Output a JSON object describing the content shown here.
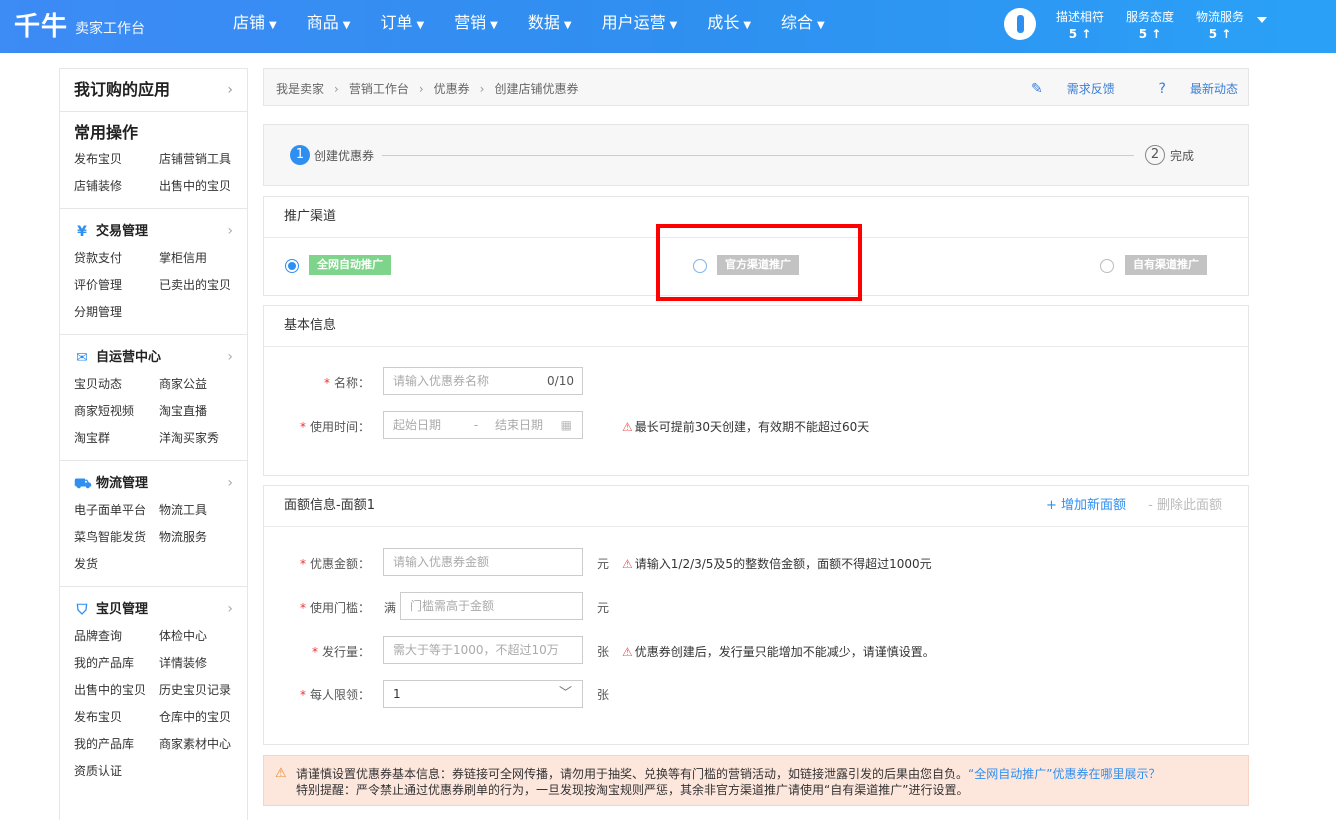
{
  "header": {
    "logo": "千牛",
    "logo_sub": "卖家工作台",
    "nav": [
      "店铺",
      "商品",
      "订单",
      "营销",
      "数据",
      "用户运营",
      "成长",
      "综合"
    ],
    "scores": [
      {
        "label": "描述相符",
        "value": "5 ↑"
      },
      {
        "label": "服务态度",
        "value": "5 ↑"
      },
      {
        "label": "物流服务",
        "value": "5 ↑"
      }
    ]
  },
  "sidebar": {
    "title": "我订购的应用",
    "common": {
      "title": "常用操作",
      "links": [
        "发布宝贝",
        "店铺营销工具",
        "店铺装修",
        "出售中的宝贝"
      ]
    },
    "sections": [
      {
        "title": "交易管理",
        "icon": "yuan-icon",
        "links": [
          "贷款支付",
          "掌柜信用",
          "评价管理",
          "已卖出的宝贝",
          "分期管理"
        ]
      },
      {
        "title": "自运营中心",
        "icon": "chat-icon",
        "links": [
          "宝贝动态",
          "商家公益",
          "商家短视频",
          "淘宝直播",
          "淘宝群",
          "洋淘买家秀"
        ]
      },
      {
        "title": "物流管理",
        "icon": "truck-icon",
        "links": [
          "电子面单平台",
          "物流工具",
          "菜鸟智能发货",
          "物流服务",
          "发货"
        ]
      },
      {
        "title": "宝贝管理",
        "icon": "bag-icon",
        "links": [
          "品牌查询",
          "体检中心",
          "我的产品库",
          "详情装修",
          "出售中的宝贝",
          "历史宝贝记录",
          "发布宝贝",
          "仓库中的宝贝",
          "我的产品库",
          "商家素材中心",
          "资质认证"
        ]
      }
    ]
  },
  "breadcrumb": {
    "items": [
      "我是卖家",
      "营销工作台",
      "优惠券",
      "创建店铺优惠券"
    ],
    "feedback": "需求反馈",
    "news": "最新动态"
  },
  "steps": [
    {
      "num": "1",
      "label": "创建优惠券"
    },
    {
      "num": "2",
      "label": "完成"
    }
  ],
  "channel": {
    "title": "推广渠道",
    "options": [
      "全网自动推广",
      "官方渠道推广",
      "自有渠道推广"
    ]
  },
  "basic": {
    "title": "基本信息",
    "name_label": "名称：",
    "name_placeholder": "请输入优惠券名称",
    "name_count": "0/10",
    "time_label": "使用时间：",
    "start_placeholder": "起始日期",
    "date_sep": "-",
    "end_placeholder": "结束日期",
    "time_tip": "最长可提前30天创建，有效期不能超过60天"
  },
  "amount": {
    "title": "面额信息-面额1",
    "add": "+ 增加新面额",
    "delete": "- 删除此面额",
    "discount_label": "优惠金额：",
    "discount_placeholder": "请输入优惠券金额",
    "unit_yuan": "元",
    "discount_tip": "请输入1/2/3/5及5的整数倍金额，面额不得超过1000元",
    "threshold_label": "使用门槛：",
    "threshold_prefix": "满",
    "threshold_placeholder": "门槛需高于金额",
    "issue_label": "发行量：",
    "issue_placeholder": "需大于等于1000，不超过10万",
    "unit_zhang": "张",
    "issue_tip": "优惠券创建后，发行量只能增加不能减少，请谨慎设置。",
    "limit_label": "每人限领：",
    "limit_value": "1"
  },
  "notice": {
    "line1": "请谨慎设置优惠券基本信息：券链接可全网传播，请勿用于抽奖、兑换等有门槛的营销活动，如链接泄露引发的后果由您自负。",
    "line1_link": "“全网自动推广”优惠券在哪里展示？",
    "line2": "特别提醒：严令禁止通过优惠券刷单的行为，一旦发现按淘宝规则严惩，其余非官方渠道推广请使用“自有渠道推广”进行设置。"
  }
}
